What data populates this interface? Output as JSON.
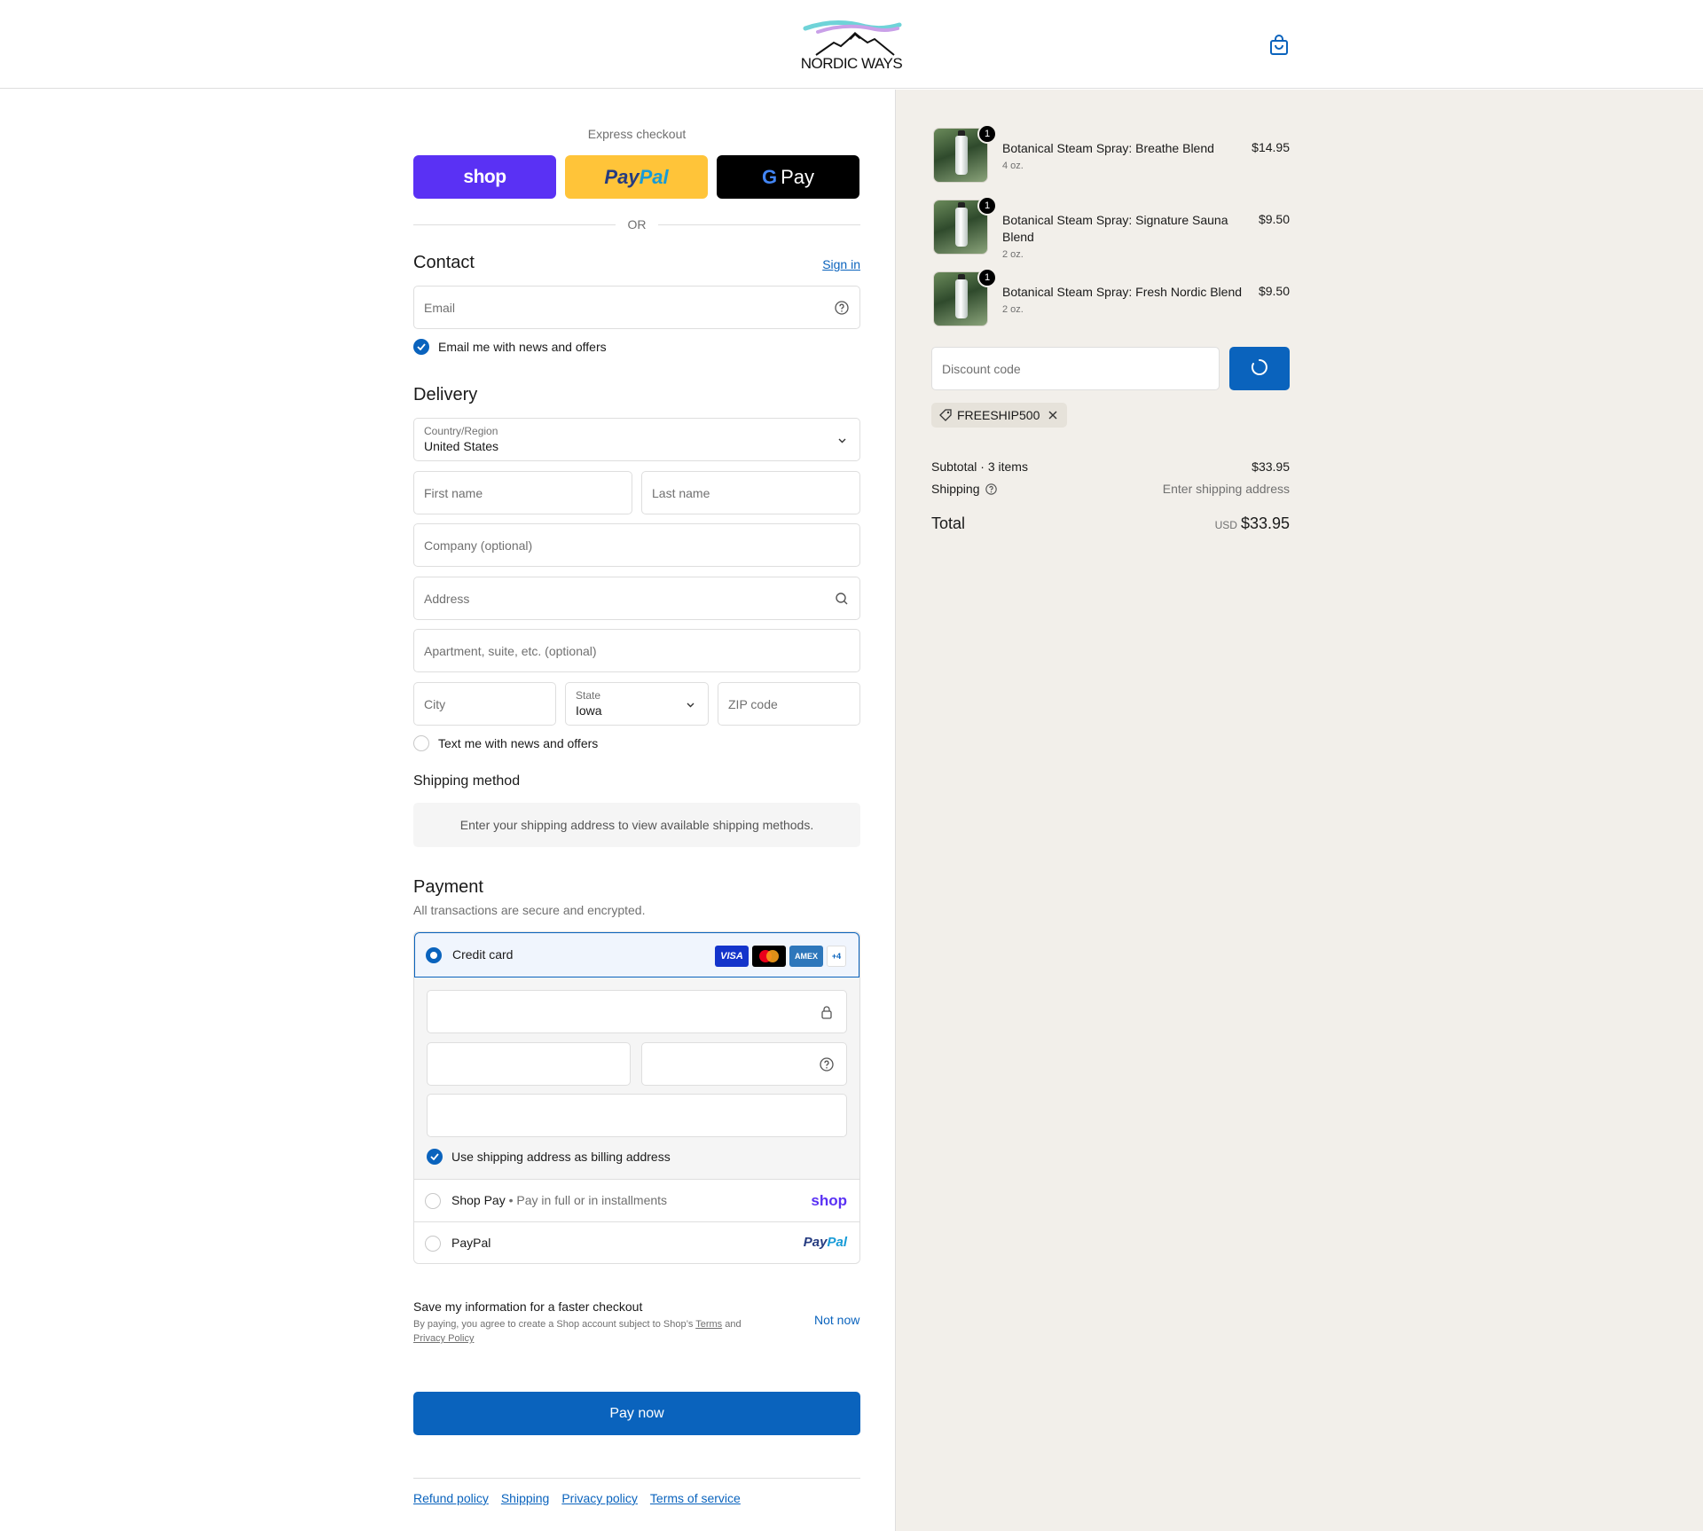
{
  "header": {
    "logo_text": "NORDIC WAYS",
    "cart_icon": "shopping-bag-icon"
  },
  "express": {
    "label": "Express checkout",
    "shop_label": "shop",
    "paypal_part1": "Pay",
    "paypal_part2": "Pal",
    "gpay_g": "G",
    "gpay_label": "Pay",
    "or_label": "OR"
  },
  "contact": {
    "heading": "Contact",
    "sign_in": "Sign in",
    "email_placeholder": "Email",
    "news_checkbox_label": "Email me with news and offers",
    "news_checked": true
  },
  "delivery": {
    "heading": "Delivery",
    "country_label": "Country/Region",
    "country_value": "United States",
    "first_name_placeholder": "First name",
    "last_name_placeholder": "Last name",
    "company_placeholder": "Company (optional)",
    "address_placeholder": "Address",
    "apartment_placeholder": "Apartment, suite, etc. (optional)",
    "city_placeholder": "City",
    "state_label": "State",
    "state_value": "Iowa",
    "zip_placeholder": "ZIP code",
    "text_checkbox_label": "Text me with news and offers",
    "text_checked": false
  },
  "shipping": {
    "heading": "Shipping method",
    "message": "Enter your shipping address to view available shipping methods."
  },
  "payment": {
    "heading": "Payment",
    "subtext": "All transactions are secure and encrypted.",
    "credit_card_label": "Credit card",
    "cards": [
      "VISA",
      "MC",
      "AMEX",
      "+4"
    ],
    "billing_label": "Use shipping address as billing address",
    "billing_checked": true,
    "shop_pay_label": "Shop Pay",
    "shop_pay_sub": "Pay in full or in installments",
    "shop_pay_logo": "shop",
    "paypal_label": "PayPal",
    "paypal_logo_1": "Pay",
    "paypal_logo_2": "Pal"
  },
  "save_info": {
    "title": "Save my information for a faster checkout",
    "legal_1": "By paying, you agree to create a Shop account subject to Shop’s",
    "terms": "Terms",
    "and": "and",
    "privacy": "Privacy Policy",
    "not_now": "Not now"
  },
  "pay_now_label": "Pay now",
  "footer": {
    "links": [
      "Refund policy",
      "Shipping",
      "Privacy policy",
      "Terms of service"
    ]
  },
  "summary": {
    "items": [
      {
        "name": "Botanical Steam Spray: Breathe Blend",
        "variant": "4 oz.",
        "price": "$14.95",
        "qty": "1"
      },
      {
        "name": "Botanical Steam Spray: Signature Sauna Blend",
        "variant": "2 oz.",
        "price": "$9.50",
        "qty": "1"
      },
      {
        "name": "Botanical Steam Spray: Fresh Nordic Blend",
        "variant": "2 oz.",
        "price": "$9.50",
        "qty": "1"
      }
    ],
    "discount_placeholder": "Discount code",
    "discount_tag": "FREESHIP500",
    "subtotal_label": "Subtotal · 3 items",
    "subtotal_value": "$33.95",
    "shipping_label": "Shipping",
    "shipping_value": "Enter shipping address",
    "total_label": "Total",
    "total_currency": "USD",
    "total_value": "$33.95"
  },
  "colors": {
    "accent": "#0a63bd",
    "shop_purple": "#5a31f4",
    "paypal_yellow": "#ffc439",
    "summary_bg": "#f2efea"
  }
}
